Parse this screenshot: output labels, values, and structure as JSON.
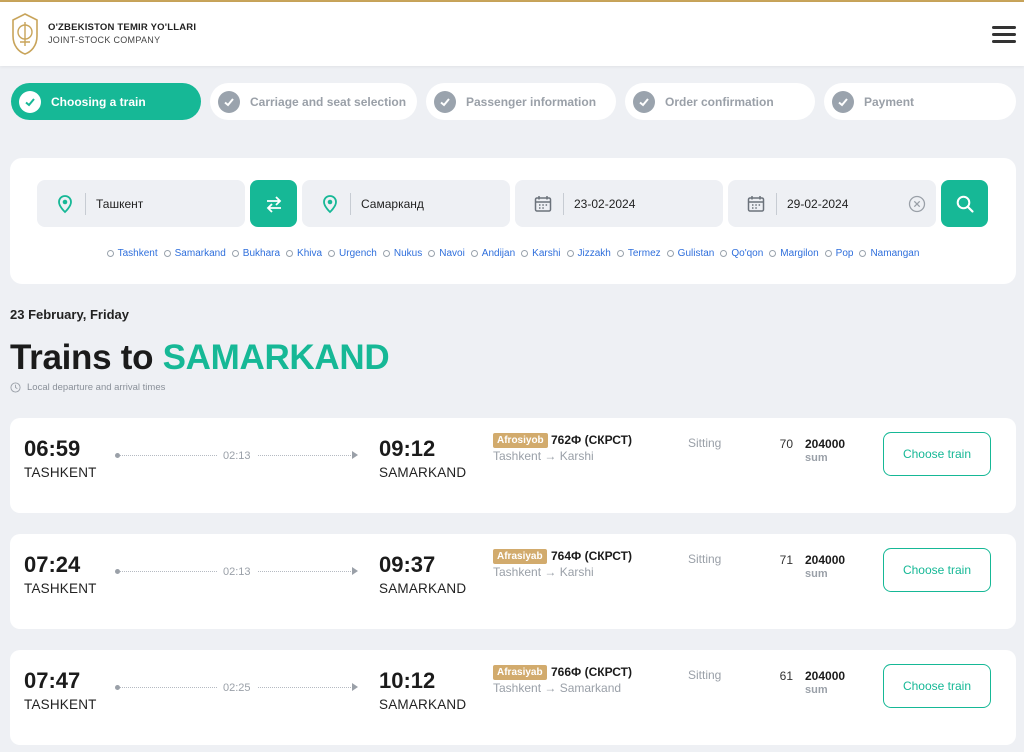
{
  "brand": {
    "name": "O'ZBEKISTON TEMIR YO'LLARI",
    "subtitle": "JOINT-STOCK COMPANY"
  },
  "steps": [
    {
      "label": "Choosing a train",
      "active": true
    },
    {
      "label": "Carriage and seat selection",
      "active": false
    },
    {
      "label": "Passenger information",
      "active": false
    },
    {
      "label": "Order confirmation",
      "active": false
    },
    {
      "label": "Payment",
      "active": false
    }
  ],
  "search": {
    "from": "Ташкент",
    "to": "Самарканд",
    "departure_date": "23-02-2024",
    "return_date": "29-02-2024"
  },
  "cities": [
    "Tashkent",
    "Samarkand",
    "Bukhara",
    "Khiva",
    "Urgench",
    "Nukus",
    "Navoi",
    "Andijan",
    "Karshi",
    "Jizzakh",
    "Termez",
    "Gulistan",
    "Qo'qon",
    "Margilon",
    "Pop",
    "Namangan"
  ],
  "results": {
    "date_line": "23 February, Friday",
    "title_prefix": "Trains to ",
    "title_dest": "SAMARKAND",
    "note": "Local departure and arrival times"
  },
  "trains": [
    {
      "dep_time": "06:59",
      "dep_city": "TASHKENT",
      "duration": "02:13",
      "arr_time": "09:12",
      "arr_city": "SAMARKAND",
      "brand": "Afrosiyob",
      "number": "762Ф (СКРСТ)",
      "route": "Tashkent → Karshi",
      "class": "Sitting",
      "seats": "70",
      "price": "204000",
      "currency": "sum",
      "button": "Choose train"
    },
    {
      "dep_time": "07:24",
      "dep_city": "TASHKENT",
      "duration": "02:13",
      "arr_time": "09:37",
      "arr_city": "SAMARKAND",
      "brand": "Afrasiyab",
      "number": "764Ф (СКРСТ)",
      "route": "Tashkent → Karshi",
      "class": "Sitting",
      "seats": "71",
      "price": "204000",
      "currency": "sum",
      "button": "Choose train"
    },
    {
      "dep_time": "07:47",
      "dep_city": "TASHKENT",
      "duration": "02:25",
      "arr_time": "10:12",
      "arr_city": "SAMARKAND",
      "brand": "Afrasiyab",
      "number": "766Ф (СКРСТ)",
      "route": "Tashkent → Samarkand",
      "class": "Sitting",
      "seats": "61",
      "price": "204000",
      "currency": "sum",
      "button": "Choose train"
    }
  ],
  "colors": {
    "accent": "#16b896",
    "badge": "#d2ab6d",
    "link": "#2f6fdc"
  }
}
